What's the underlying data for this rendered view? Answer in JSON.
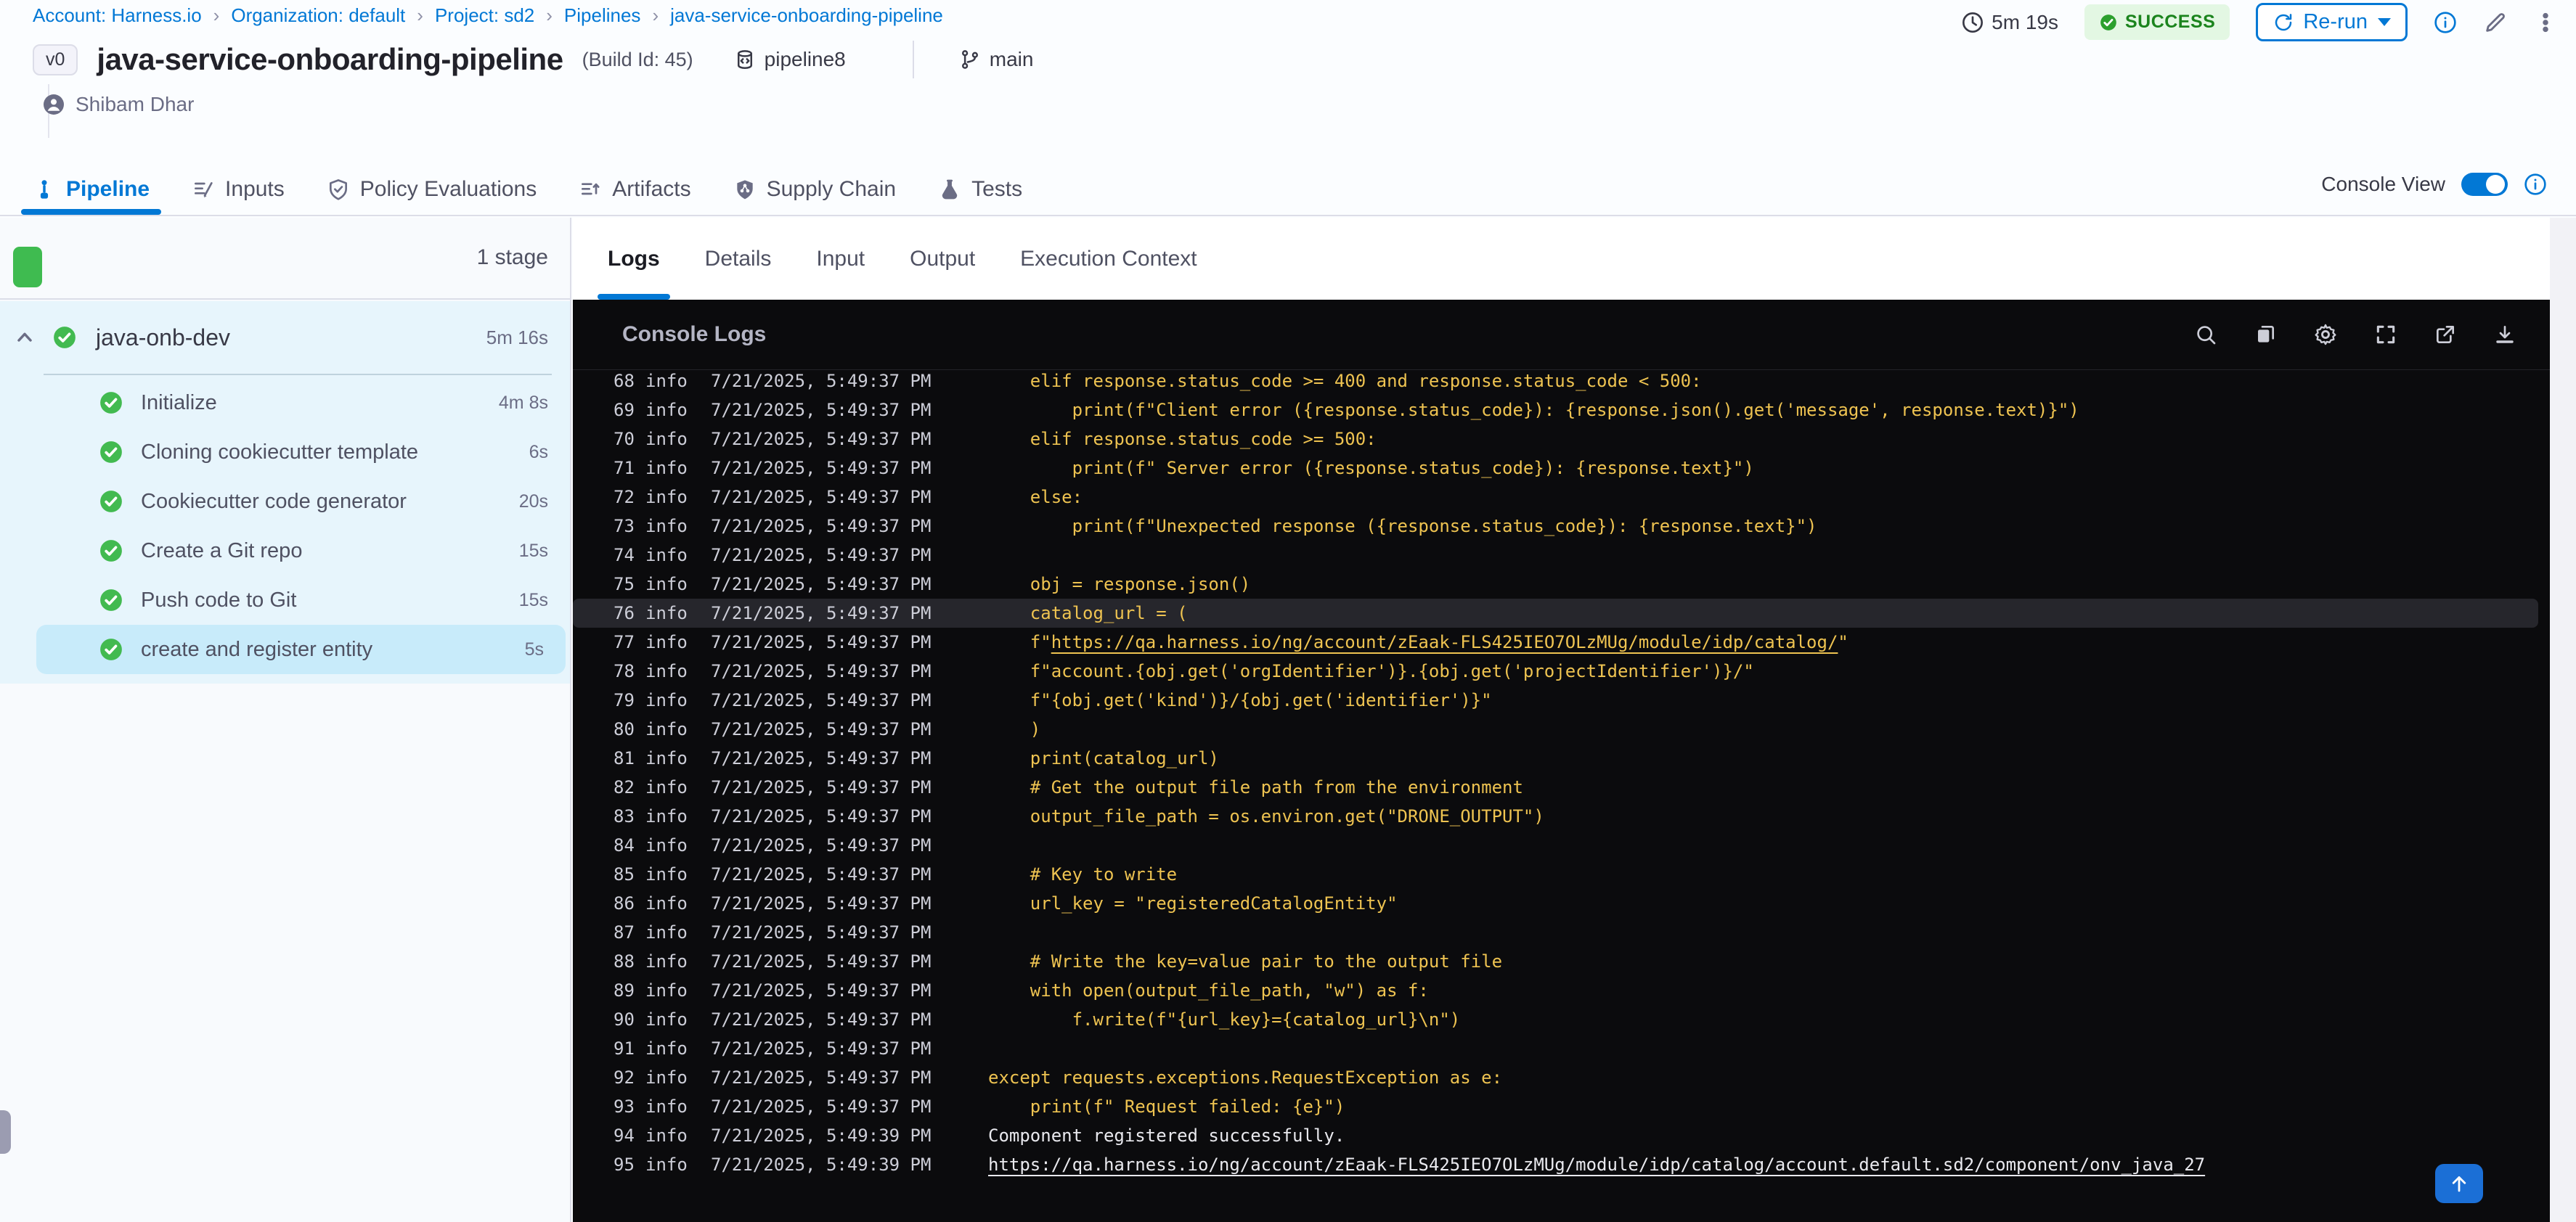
{
  "colors": {
    "accent": "#0278d5",
    "success_text": "#1b841d",
    "success_bg": "#e3f7e3",
    "green": "#42ba50",
    "code_gold": "#eec351",
    "console_bg": "#0b0b0d"
  },
  "breadcrumb": {
    "separator": "›",
    "items": [
      "Account: Harness.io",
      "Organization: default",
      "Project: sd2",
      "Pipelines",
      "java-service-onboarding-pipeline"
    ]
  },
  "header": {
    "version_badge": "v0",
    "title": "java-service-onboarding-pipeline",
    "build_id": "(Build Id: 45)",
    "pipeline_ref": "pipeline8",
    "branch": "main",
    "user": "Shibam Dhar",
    "duration": "5m 19s",
    "status": "SUCCESS",
    "rerun_label": "Re-run"
  },
  "tabs": [
    {
      "label": "Pipeline",
      "icon": "pipeline",
      "active": true
    },
    {
      "label": "Inputs",
      "icon": "inputs",
      "active": false
    },
    {
      "label": "Policy Evaluations",
      "icon": "shield-check",
      "active": false
    },
    {
      "label": "Artifacts",
      "icon": "artifacts",
      "active": false
    },
    {
      "label": "Supply Chain",
      "icon": "supply-chain",
      "active": false
    },
    {
      "label": "Tests",
      "icon": "flask",
      "active": false
    }
  ],
  "console_view": {
    "label": "Console View",
    "enabled": true
  },
  "sidebar": {
    "stage_count_label": "1 stage",
    "stage": {
      "name": "java-onb-dev",
      "duration": "5m 16s",
      "status": "success"
    },
    "steps": [
      {
        "name": "Initialize",
        "duration": "4m 8s",
        "selected": false
      },
      {
        "name": "Cloning cookiecutter template",
        "duration": "6s",
        "selected": false
      },
      {
        "name": "Cookiecutter code generator",
        "duration": "20s",
        "selected": false
      },
      {
        "name": "Create a Git repo",
        "duration": "15s",
        "selected": false
      },
      {
        "name": "Push code to Git",
        "duration": "15s",
        "selected": false
      },
      {
        "name": "create and register entity",
        "duration": "5s",
        "selected": true
      }
    ]
  },
  "log_panel": {
    "tabs": [
      {
        "label": "Logs",
        "active": true
      },
      {
        "label": "Details",
        "active": false
      },
      {
        "label": "Input",
        "active": false
      },
      {
        "label": "Output",
        "active": false
      },
      {
        "label": "Execution Context",
        "active": false
      }
    ],
    "console_title": "Console Logs",
    "toolbar_icons": [
      "search",
      "copy",
      "settings",
      "fullscreen",
      "open-in-new",
      "download"
    ]
  },
  "logs": {
    "lines": [
      {
        "n": "68",
        "level": "info",
        "ts": "7/21/2025, 5:49:37 PM",
        "code": "    elif response.status_code >= 400 and response.status_code < 500:"
      },
      {
        "n": "69",
        "level": "info",
        "ts": "7/21/2025, 5:49:37 PM",
        "code": "        print(f\"Client error ({response.status_code}): {response.json().get('message', response.text)}\")"
      },
      {
        "n": "70",
        "level": "info",
        "ts": "7/21/2025, 5:49:37 PM",
        "code": "    elif response.status_code >= 500:"
      },
      {
        "n": "71",
        "level": "info",
        "ts": "7/21/2025, 5:49:37 PM",
        "code": "        print(f\" Server error ({response.status_code}): {response.text}\")"
      },
      {
        "n": "72",
        "level": "info",
        "ts": "7/21/2025, 5:49:37 PM",
        "code": "    else:"
      },
      {
        "n": "73",
        "level": "info",
        "ts": "7/21/2025, 5:49:37 PM",
        "code": "        print(f\"Unexpected response ({response.status_code}): {response.text}\")"
      },
      {
        "n": "74",
        "level": "info",
        "ts": "7/21/2025, 5:49:37 PM",
        "code": ""
      },
      {
        "n": "75",
        "level": "info",
        "ts": "7/21/2025, 5:49:37 PM",
        "code": "    obj = response.json()"
      },
      {
        "n": "76",
        "level": "info",
        "ts": "7/21/2025, 5:49:37 PM",
        "code": "    catalog_url = (",
        "highlight": true
      },
      {
        "n": "77",
        "level": "info",
        "ts": "7/21/2025, 5:49:37 PM",
        "segments": [
          {
            "t": "    f\"",
            "u": false
          },
          {
            "t": "https://qa.harness.io/ng/account/zEaak-FLS425IEO7OLzMUg/module/idp/catalog/",
            "u": true
          },
          {
            "t": "\"",
            "u": false
          }
        ]
      },
      {
        "n": "78",
        "level": "info",
        "ts": "7/21/2025, 5:49:37 PM",
        "code": "    f\"account.{obj.get('orgIdentifier')}.{obj.get('projectIdentifier')}/\""
      },
      {
        "n": "79",
        "level": "info",
        "ts": "7/21/2025, 5:49:37 PM",
        "code": "    f\"{obj.get('kind')}/{obj.get('identifier')}\""
      },
      {
        "n": "80",
        "level": "info",
        "ts": "7/21/2025, 5:49:37 PM",
        "code": "    )"
      },
      {
        "n": "81",
        "level": "info",
        "ts": "7/21/2025, 5:49:37 PM",
        "code": "    print(catalog_url)"
      },
      {
        "n": "82",
        "level": "info",
        "ts": "7/21/2025, 5:49:37 PM",
        "code": "    # Get the output file path from the environment"
      },
      {
        "n": "83",
        "level": "info",
        "ts": "7/21/2025, 5:49:37 PM",
        "code": "    output_file_path = os.environ.get(\"DRONE_OUTPUT\")"
      },
      {
        "n": "84",
        "level": "info",
        "ts": "7/21/2025, 5:49:37 PM",
        "code": ""
      },
      {
        "n": "85",
        "level": "info",
        "ts": "7/21/2025, 5:49:37 PM",
        "code": "    # Key to write"
      },
      {
        "n": "86",
        "level": "info",
        "ts": "7/21/2025, 5:49:37 PM",
        "code": "    url_key = \"registeredCatalogEntity\""
      },
      {
        "n": "87",
        "level": "info",
        "ts": "7/21/2025, 5:49:37 PM",
        "code": ""
      },
      {
        "n": "88",
        "level": "info",
        "ts": "7/21/2025, 5:49:37 PM",
        "code": "    # Write the key=value pair to the output file"
      },
      {
        "n": "89",
        "level": "info",
        "ts": "7/21/2025, 5:49:37 PM",
        "code": "    with open(output_file_path, \"w\") as f:"
      },
      {
        "n": "90",
        "level": "info",
        "ts": "7/21/2025, 5:49:37 PM",
        "code": "        f.write(f\"{url_key}={catalog_url}\\n\")"
      },
      {
        "n": "91",
        "level": "info",
        "ts": "7/21/2025, 5:49:37 PM",
        "code": ""
      },
      {
        "n": "92",
        "level": "info",
        "ts": "7/21/2025, 5:49:37 PM",
        "code": "except requests.exceptions.RequestException as e:"
      },
      {
        "n": "93",
        "level": "info",
        "ts": "7/21/2025, 5:49:37 PM",
        "code": "    print(f\" Request failed: {e}\")"
      },
      {
        "n": "94",
        "level": "info",
        "ts": "7/21/2025, 5:49:39 PM",
        "code": "Component registered successfully.",
        "variant": "plain"
      },
      {
        "n": "95",
        "level": "info",
        "ts": "7/21/2025, 5:49:39 PM",
        "variant": "plain",
        "segments": [
          {
            "t": "https://qa.harness.io/ng/account/zEaak-FLS425IEO7OLzMUg/module/idp/catalog/account.default.sd2/component/onv_java_27",
            "u": true
          }
        ]
      }
    ]
  }
}
